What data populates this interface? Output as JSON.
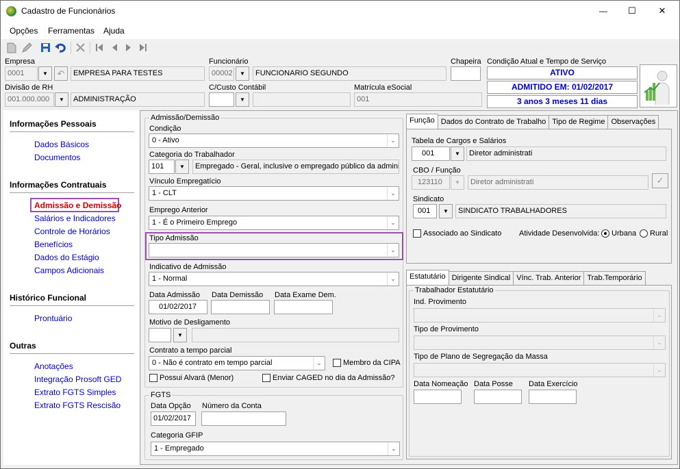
{
  "window": {
    "title": "Cadastro de Funcionários",
    "minimize": "—",
    "maximize": "☐",
    "close": "✕"
  },
  "menu": [
    "Opções",
    "Ferramentas",
    "Ajuda"
  ],
  "header": {
    "empresa_label": "Empresa",
    "empresa_code": "0001",
    "empresa_name": "EMPRESA PARA TESTES",
    "funcionario_label": "Funcionário",
    "funcionario_code": "00002",
    "funcionario_name": "FUNCIONARIO SEGUNDO",
    "chapeira_label": "Chapeira",
    "chapeira_value": "",
    "condicao_label": "Condição Atual e Tempo de Serviço",
    "status_ativo": "ATIVO",
    "status_admitido": "ADMITIDO EM: 01/02/2017",
    "status_tempo": "3 anos 3 meses 11 dias",
    "divisao_label": "Divisão de RH",
    "divisao_code": "001.000.000",
    "divisao_name": "ADMINISTRAÇÃO",
    "custo_label": "C/Custo Contábil",
    "custo_value": "",
    "matricula_label": "Matrícula eSocial",
    "matricula_value": "001"
  },
  "sidebar": {
    "sec1": "Informações Pessoais",
    "sec1_items": [
      "Dados Básicos",
      "Documentos"
    ],
    "sec2": "Informações Contratuais",
    "sec2_items": [
      "Admissão e Demissão",
      "Salários e Indicadores",
      "Controle de Horários",
      "Benefícios",
      "Dados do Estágio",
      "Campos Adicionais"
    ],
    "sec3": "Histórico Funcional",
    "sec3_items": [
      "Prontuário"
    ],
    "sec4": "Outras",
    "sec4_items": [
      "Anotações",
      "Integração Prosoft GED",
      "Extrato FGTS Simples",
      "Extrato FGTS Rescisão"
    ],
    "active_color": "#d40000"
  },
  "admissao": {
    "group": "Admissão/Demissão",
    "condicao_label": "Condição",
    "condicao_value": "0 - Ativo",
    "categoria_label": "Categoria do Trabalhador",
    "categoria_code": "101",
    "categoria_desc": "Empregado - Geral, inclusive o empregado público da administ",
    "vinculo_label": "Vínculo Empregatício",
    "vinculo_value": "1 - CLT",
    "emprego_label": "Emprego Anterior",
    "emprego_value": "1 - É o Primeiro Emprego",
    "tipo_label": "Tipo Admissão",
    "tipo_value": "",
    "indicativo_label": "Indicativo de Admissão",
    "indicativo_value": "1 - Normal",
    "data_adm_label": "Data Admissão",
    "data_adm_value": "01/02/2017",
    "data_dem_label": "Data Demissão",
    "data_dem_value": "",
    "data_exame_label": "Data Exame Dem.",
    "data_exame_value": "",
    "motivo_label": "Motivo de Desligamento",
    "contrato_label": "Contrato a tempo parcial",
    "contrato_value": "0 - Não é contrato em tempo parcial",
    "membro_cipa": "Membro da CIPA",
    "alvara": "Possui Alvará (Menor)",
    "caged": "Enviar CAGED no dia da Admissão?"
  },
  "fgts": {
    "group": "FGTS",
    "data_opcao_label": "Data Opção",
    "data_opcao_value": "01/02/2017",
    "conta_label": "Número da Conta",
    "conta_value": "",
    "gfip_label": "Categoria GFIP",
    "gfip_value": "1 - Empregado"
  },
  "tabs_top": [
    "Função",
    "Dados do Contrato de Trabalho",
    "Tipo de Regime",
    "Observações"
  ],
  "funcao": {
    "tabela_label": "Tabela de Cargos e Salários",
    "tabela_code": "001",
    "tabela_desc": "Diretor administrati",
    "cbo_label": "CBO / Função",
    "cbo_code": "123110",
    "cbo_desc": "Diretor administrati",
    "sindicato_label": "Sindicato",
    "sindicato_code": "001",
    "sindicato_desc": "SINDICATO TRABALHADORES",
    "associado": "Associado ao Sindicato",
    "atividade_label": "Atividade Desenvolvida:",
    "urbana": "Urbana",
    "rural": "Rural"
  },
  "tabs_bottom": [
    "Estatutário",
    "Dirigente Sindical",
    "Vínc. Trab. Anterior",
    "Trab.Temporário"
  ],
  "estatutario": {
    "group": "Trabalhador Estatutário",
    "ind_label": "Ind. Provimento",
    "tipo_prov_label": "Tipo de Provimento",
    "tipo_plano_label": "Tipo de Plano de Segregação da Massa",
    "nomeacao_label": "Data Nomeação",
    "posse_label": "Data Posse",
    "exercicio_label": "Data Exercício"
  }
}
